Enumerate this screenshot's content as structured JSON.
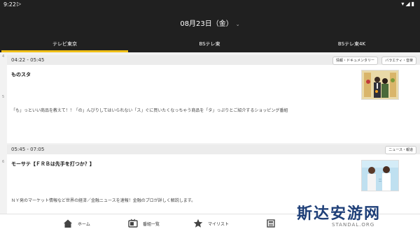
{
  "status_bar": {
    "time": "9:22"
  },
  "header": {
    "date": "08月23日（金）"
  },
  "tabs": [
    {
      "label": "テレビ東京"
    },
    {
      "label": "BSテレ東"
    },
    {
      "label": "BSテレ東4K"
    }
  ],
  "programs": [
    {
      "time": "04:22 - 05:45",
      "genres": [
        "情報・ドキュメンタリー",
        "バラエティ・音楽"
      ],
      "title": "ものスタ",
      "description": "「も」っといい商品を教えて！！「の」んびりしてはいられない「ス」ぐに買いたくなっちゃう商品を「タ」っぷりとご紹介するショッピング番組",
      "row_num": "5"
    },
    {
      "time": "05:45 - 07:05",
      "genres": [
        "ニュース・報道"
      ],
      "title": "モーサテ【ＦＲＢは先手を打つか？】",
      "description": "ＮＹ発のマーケット情報など世界の経済／金融ニュースを速報！金融のプロが詳しく解説します。",
      "row_num": "6"
    }
  ],
  "side_row_num": "4",
  "bottom_nav": [
    {
      "label": "ホーム",
      "icon": "home-icon"
    },
    {
      "label": "番組一覧",
      "icon": "tv-guide-icon"
    },
    {
      "label": "マイリスト",
      "icon": "star-icon"
    },
    {
      "label": "",
      "icon": "news-icon"
    }
  ],
  "watermark": {
    "text": "斯达安游网",
    "subtext": "STANDAL.ORG"
  },
  "colors": {
    "header_bg": "#202020",
    "accent": "#f0c018",
    "watermark": "#1e3f78"
  }
}
